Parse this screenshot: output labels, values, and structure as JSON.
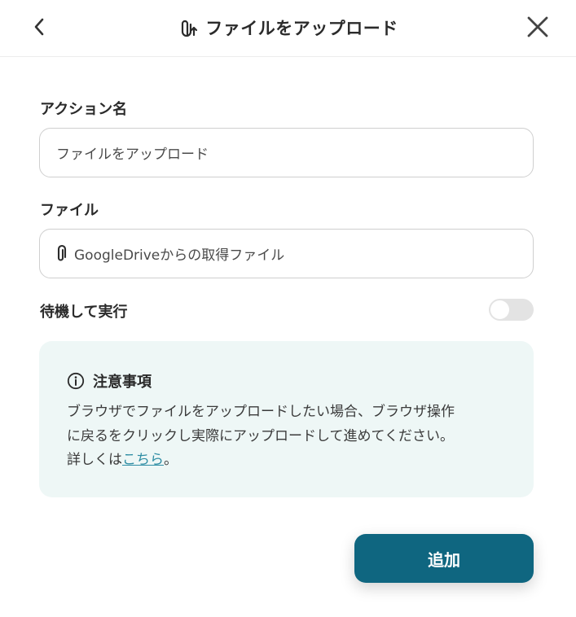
{
  "header": {
    "title": "ファイルをアップロード",
    "back_icon": "chevron-left-icon",
    "title_icon": "paperclip-upload-icon",
    "close_icon": "close-icon"
  },
  "form": {
    "action_name": {
      "label": "アクション名",
      "value": "ファイルをアップロード"
    },
    "file": {
      "label": "ファイル",
      "icon": "paperclip-icon",
      "value": "GoogleDriveからの取得ファイル"
    },
    "wait": {
      "label": "待機して実行",
      "enabled": false
    }
  },
  "notice": {
    "icon": "info-icon",
    "title": "注意事項",
    "body_line1": "ブラウザでファイルをアップロードしたい場合、ブラウザ操作",
    "body_line2": "に戻るをクリックし実際にアップロードして進めてください。",
    "body_prefix": "詳しくは",
    "link_text": "こちら",
    "body_suffix": "。"
  },
  "actions": {
    "add_label": "追加"
  },
  "colors": {
    "primary": "#0f6680",
    "notice_bg": "#eef7f6",
    "link": "#2e8da4",
    "toggle_off": "#e3e3e3"
  }
}
